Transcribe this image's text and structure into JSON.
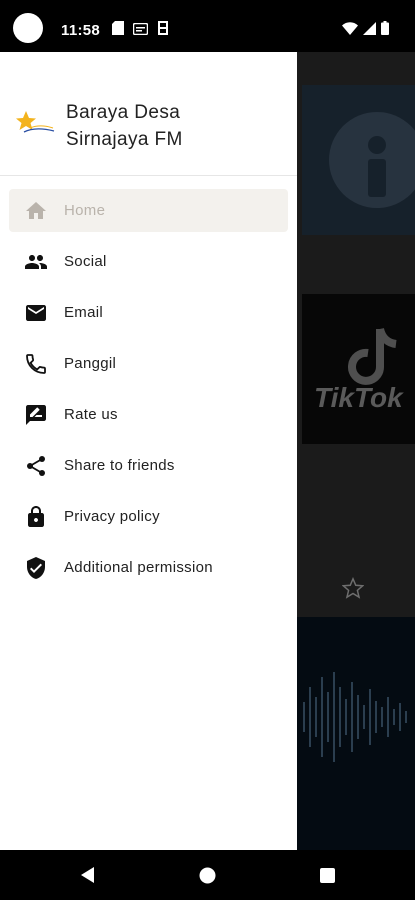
{
  "status_bar": {
    "time": "11:58",
    "icons": [
      "sd-card-icon",
      "message-icon",
      "sync-icon",
      "wifi-icon",
      "signal-icon",
      "battery-icon"
    ]
  },
  "drawer": {
    "title_line1": "Baraya Desa",
    "title_line2": "Sirnajaya FM",
    "items": [
      {
        "label": "Home",
        "icon": "home-icon",
        "active": true
      },
      {
        "label": "Social",
        "icon": "people-icon"
      },
      {
        "label": "Email",
        "icon": "mail-icon"
      },
      {
        "label": "Panggil",
        "icon": "phone-icon"
      },
      {
        "label": "Rate us",
        "icon": "rate-icon"
      },
      {
        "label": "Share to friends",
        "icon": "share-icon"
      },
      {
        "label": "Privacy policy",
        "icon": "lock-icon"
      },
      {
        "label": "Additional permission",
        "icon": "shield-icon"
      }
    ]
  },
  "background": {
    "card2_text": "TikTok"
  },
  "colors": {
    "active_bg": "#f3f1ed",
    "active_text": "#b9b3ab",
    "text": "#222222",
    "logo_star": "#f3b31d"
  }
}
